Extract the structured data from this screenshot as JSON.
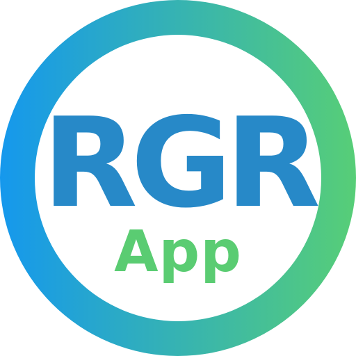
{
  "logo": {
    "title": "RGR",
    "subtitle": "App",
    "colors": {
      "ring_start": "#1598ED",
      "ring_end": "#57CE77",
      "title": "#2789C8",
      "subtitle": "#5ACC72",
      "inner": "#FFFFFF"
    }
  }
}
